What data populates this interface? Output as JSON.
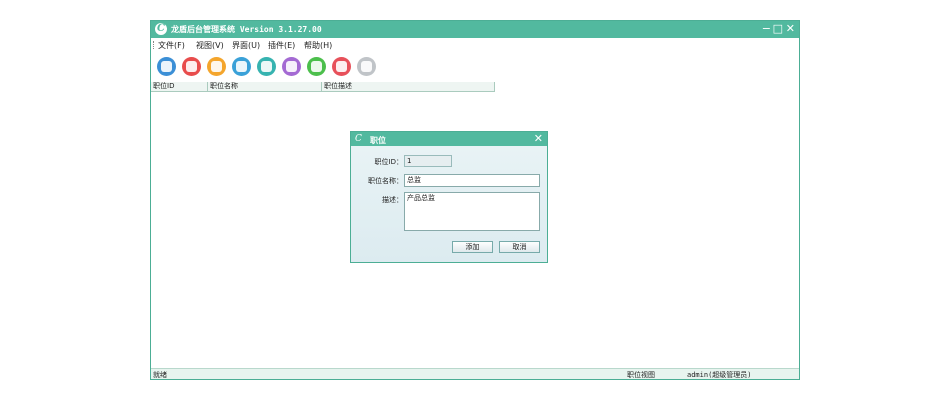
{
  "window": {
    "title": "龙盾后台管理系统 Version 3.1.27.00",
    "logo_glyph": "C",
    "minimize_glyph": "−",
    "maximize_glyph": "□",
    "close_glyph": "✕"
  },
  "menu": {
    "items": [
      {
        "label": "文件(F)"
      },
      {
        "label": "视图(V)"
      },
      {
        "label": "界面(U)"
      },
      {
        "label": "插件(E)"
      },
      {
        "label": "帮助(H)"
      }
    ]
  },
  "toolbar": {
    "buttons": [
      {
        "icon": "users-icon",
        "color": "#3b8fd6"
      },
      {
        "icon": "home-icon",
        "color": "#e84c4c"
      },
      {
        "icon": "list-icon",
        "color": "#f4a52c"
      },
      {
        "icon": "user-icon",
        "color": "#3aa1d8"
      },
      {
        "icon": "id-card-icon",
        "color": "#36b3b0"
      },
      {
        "icon": "message-icon",
        "color": "#a46ad3"
      },
      {
        "icon": "check-icon",
        "color": "#4cbf4c"
      },
      {
        "icon": "sound-icon",
        "color": "#e7505a"
      },
      {
        "icon": "info-icon",
        "color": "#c0c4c8"
      }
    ]
  },
  "list": {
    "columns": [
      "职位ID",
      "职位名称",
      "职位描述"
    ]
  },
  "dialog": {
    "title": "职位",
    "logo_glyph": "C",
    "close_glyph": "✕",
    "id_label": "职位ID：",
    "id_value": "1",
    "name_label": "职位名称：",
    "name_value": "总监",
    "desc_label": "描述：",
    "desc_value": "产品总监",
    "add_label": "添加",
    "cancel_label": "取消"
  },
  "status": {
    "left": "就绪",
    "view": "职位视图",
    "user": "admin(超级管理员)"
  },
  "colors": {
    "accent": "#52b99f"
  }
}
